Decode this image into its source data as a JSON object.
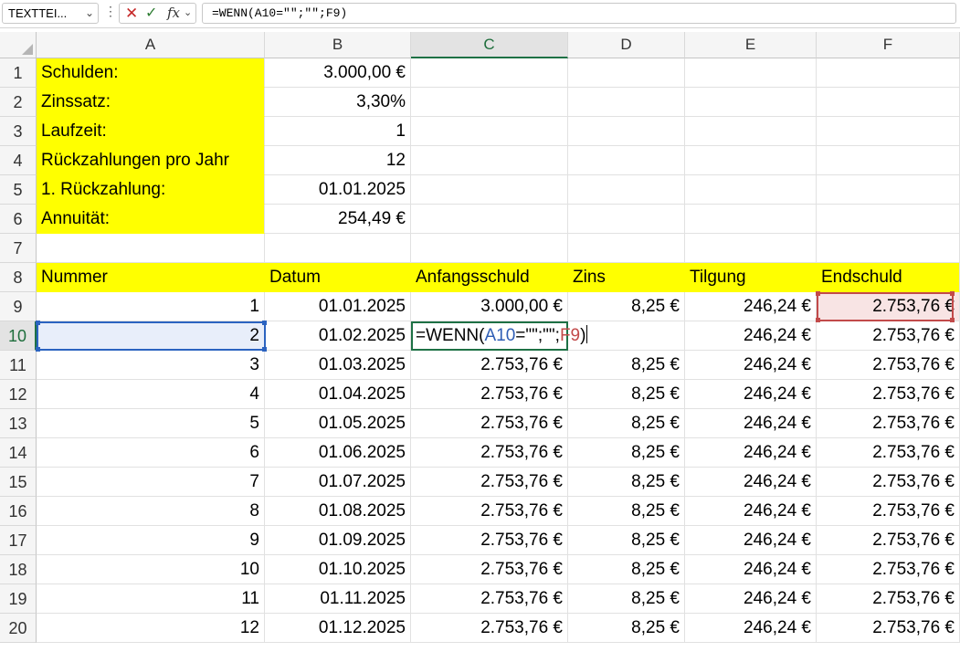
{
  "formula_bar": {
    "name_box": "TEXTTEI...",
    "cancel_icon": "x-icon",
    "enter_icon": "check-icon",
    "function_icon": "fx",
    "formula": "=WENN(A10=\"\";\"\";F9)"
  },
  "columns": [
    "A",
    "B",
    "C",
    "D",
    "E",
    "F"
  ],
  "rows": [
    "1",
    "2",
    "3",
    "4",
    "5",
    "6",
    "7",
    "8",
    "9",
    "10",
    "11",
    "12",
    "13",
    "14",
    "15",
    "16",
    "17",
    "18",
    "19",
    "20"
  ],
  "summary": [
    {
      "label": "Schulden:",
      "value": "3.000,00 €"
    },
    {
      "label": "Zinssatz:",
      "value": "3,30%"
    },
    {
      "label": "Laufzeit:",
      "value": "1"
    },
    {
      "label": "Rückzahlungen pro Jahr",
      "value": "12"
    },
    {
      "label": "1. Rückzahlung:",
      "value": "01.01.2025"
    },
    {
      "label": "Annuität:",
      "value": "254,49 €"
    }
  ],
  "table": {
    "headers": [
      "Nummer",
      "Datum",
      "Anfangsschuld",
      "Zins",
      "Tilgung",
      "Endschuld"
    ],
    "rows": [
      [
        "1",
        "01.01.2025",
        "3.000,00 €",
        "8,25 €",
        "246,24 €",
        "2.753,76 €"
      ],
      [
        "2",
        "01.02.2025",
        "",
        "",
        "246,24 €",
        "2.753,76 €"
      ],
      [
        "3",
        "01.03.2025",
        "2.753,76 €",
        "8,25 €",
        "246,24 €",
        "2.753,76 €"
      ],
      [
        "4",
        "01.04.2025",
        "2.753,76 €",
        "8,25 €",
        "246,24 €",
        "2.753,76 €"
      ],
      [
        "5",
        "01.05.2025",
        "2.753,76 €",
        "8,25 €",
        "246,24 €",
        "2.753,76 €"
      ],
      [
        "6",
        "01.06.2025",
        "2.753,76 €",
        "8,25 €",
        "246,24 €",
        "2.753,76 €"
      ],
      [
        "7",
        "01.07.2025",
        "2.753,76 €",
        "8,25 €",
        "246,24 €",
        "2.753,76 €"
      ],
      [
        "8",
        "01.08.2025",
        "2.753,76 €",
        "8,25 €",
        "246,24 €",
        "2.753,76 €"
      ],
      [
        "9",
        "01.09.2025",
        "2.753,76 €",
        "8,25 €",
        "246,24 €",
        "2.753,76 €"
      ],
      [
        "10",
        "01.10.2025",
        "2.753,76 €",
        "8,25 €",
        "246,24 €",
        "2.753,76 €"
      ],
      [
        "11",
        "01.11.2025",
        "2.753,76 €",
        "8,25 €",
        "246,24 €",
        "2.753,76 €"
      ],
      [
        "12",
        "01.12.2025",
        "2.753,76 €",
        "8,25 €",
        "246,24 €",
        "2.753,76 €"
      ]
    ]
  },
  "editing_cell": {
    "address": "C10",
    "tokens": {
      "t1": "=WENN(",
      "t2": "A10",
      "t3": "=\"\";\"\";",
      "t4": "F9",
      "t5": ")"
    }
  },
  "colors": {
    "highlight": "#ffff00",
    "selection": "#2b63c0",
    "reference": "#c24a4a",
    "edit_border": "#1e7145"
  }
}
